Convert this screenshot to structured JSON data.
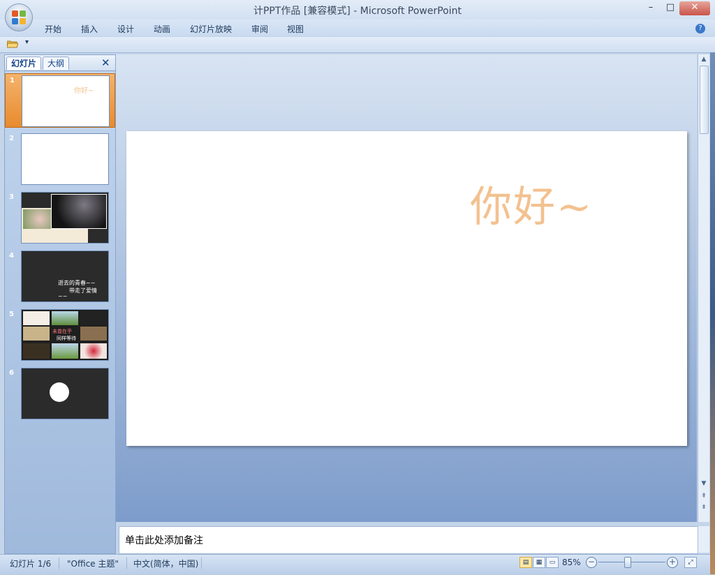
{
  "window": {
    "title": "计PPT作品 [兼容模式] - Microsoft PowerPoint",
    "min_symbol": "–",
    "max_symbol": "□",
    "close_symbol": "✕"
  },
  "ribbon": {
    "tabs": [
      "开始",
      "插入",
      "设计",
      "动画",
      "幻灯片放映",
      "审阅",
      "视图"
    ],
    "help_symbol": "?"
  },
  "quick_access": {
    "dropdown_symbol": "▾"
  },
  "left_pane": {
    "tab_slides": "幻灯片",
    "tab_outline": "大纲",
    "close_symbol": "✕",
    "slides": [
      {
        "number": "1",
        "text": "你好~",
        "selected": true
      },
      {
        "number": "2",
        "text": ""
      },
      {
        "number": "3",
        "text": ""
      },
      {
        "number": "4",
        "text_line1": "逝去的青春~~",
        "text_line2": "带走了爱情",
        "text_line3": "~~"
      },
      {
        "number": "5",
        "text_line1": "未曾在乎",
        "text_line2": "同样等待"
      },
      {
        "number": "6",
        "text": ""
      }
    ]
  },
  "slide": {
    "title_text": "你好~"
  },
  "notes": {
    "placeholder": "单击此处添加备注"
  },
  "status_bar": {
    "slide_info": "幻灯片 1/6",
    "theme": "\"Office 主题\"",
    "language": "中文(简体，中国)",
    "zoom": "85%",
    "zoom_minus": "−",
    "zoom_plus": "+"
  },
  "colors": {
    "slide_text": "#f3c18f",
    "selection": "#e88b2e",
    "ribbon_bg": "#d2e0f2"
  }
}
